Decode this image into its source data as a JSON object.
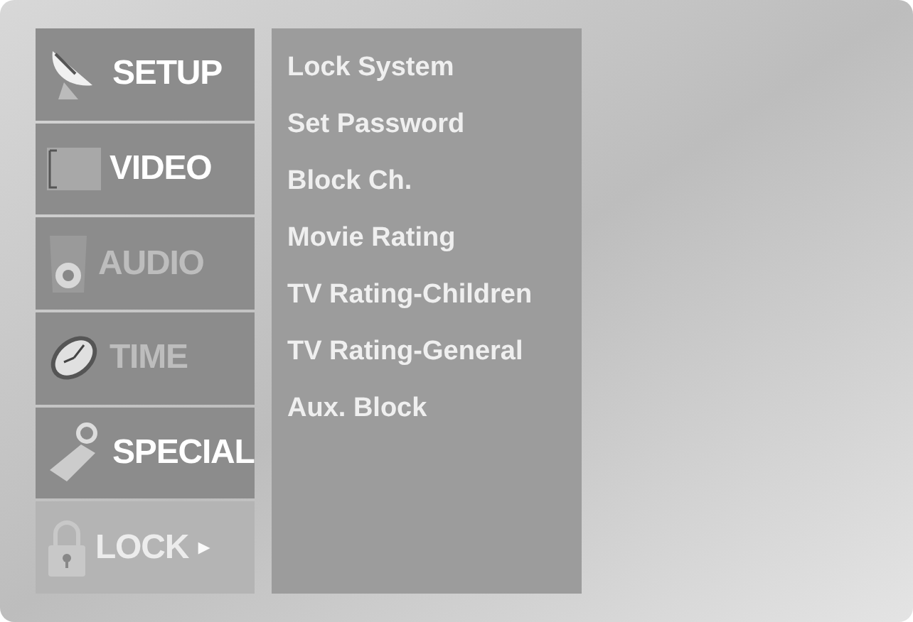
{
  "main_menu": [
    {
      "label": "SETUP",
      "kind": "dish",
      "selected": false,
      "dimmed": false
    },
    {
      "label": "VIDEO",
      "kind": "screen",
      "selected": false,
      "dimmed": false
    },
    {
      "label": "AUDIO",
      "kind": "speaker",
      "selected": false,
      "dimmed": true
    },
    {
      "label": "TIME",
      "kind": "clock",
      "selected": false,
      "dimmed": true
    },
    {
      "label": "SPECIAL",
      "kind": "tag",
      "selected": false,
      "dimmed": false
    },
    {
      "label": "LOCK",
      "kind": "padlock",
      "selected": true,
      "dimmed": false,
      "arrow": "►"
    }
  ],
  "submenu": [
    {
      "label": "Lock System"
    },
    {
      "label": "Set Password"
    },
    {
      "label": "Block Ch."
    },
    {
      "label": "Movie Rating"
    },
    {
      "label": "TV Rating-Children"
    },
    {
      "label": "TV Rating-General"
    },
    {
      "label": "Aux. Block"
    }
  ]
}
